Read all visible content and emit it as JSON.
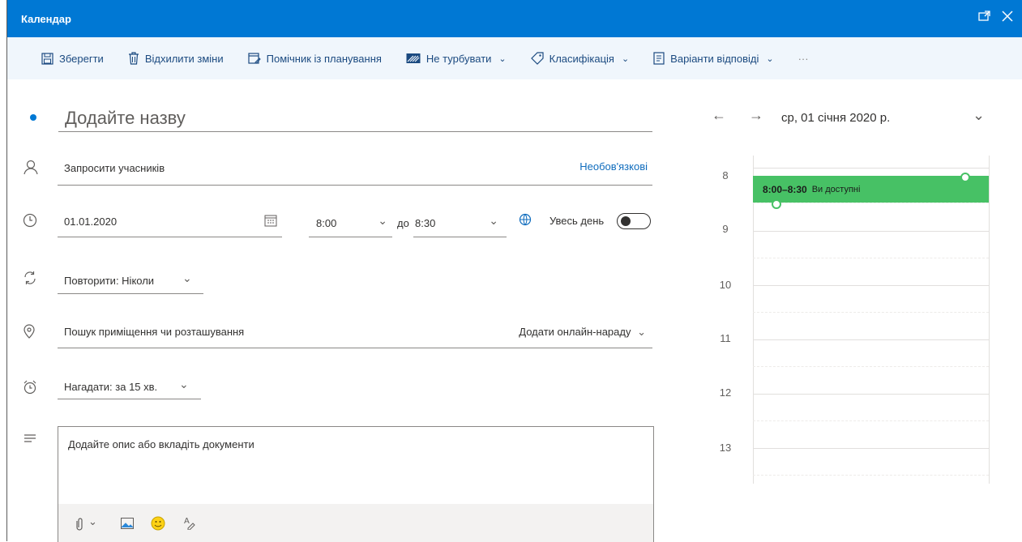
{
  "window": {
    "title": "Календар"
  },
  "toolbar": {
    "save": "Зберегти",
    "discard": "Відхилити зміни",
    "scheduling": "Помічник із планування",
    "dnd": "Не турбувати",
    "classify": "Класифікація",
    "reply_options": "Варіанти відповіді",
    "more": "···"
  },
  "form": {
    "title_placeholder": "Додайте назву",
    "attendees_placeholder": "Запросити учасників",
    "optional_link": "Необов'язкові",
    "date": "01.01.2020",
    "start_time": "8:00",
    "to_label": "до",
    "end_time": "8:30",
    "all_day_label": "Увесь день",
    "all_day": false,
    "repeat": "Повторити: Ніколи",
    "location_placeholder": "Пошук приміщення чи розташування",
    "online_meeting": "Додати онлайн-нараду",
    "reminder": "Нагадати: за 15 хв.",
    "description_placeholder": "Додайте опис або вкладіть документи"
  },
  "calendar": {
    "date_label": "ср, 01 січня 2020 р.",
    "hours": [
      "8",
      "9",
      "10",
      "11",
      "12",
      "13"
    ],
    "event_time": "8:00–8:30",
    "event_status": "Ви доступні"
  },
  "colors": {
    "accent": "#0078d4",
    "event": "#47c165",
    "toolbar_bg": "#f0f6fc"
  }
}
